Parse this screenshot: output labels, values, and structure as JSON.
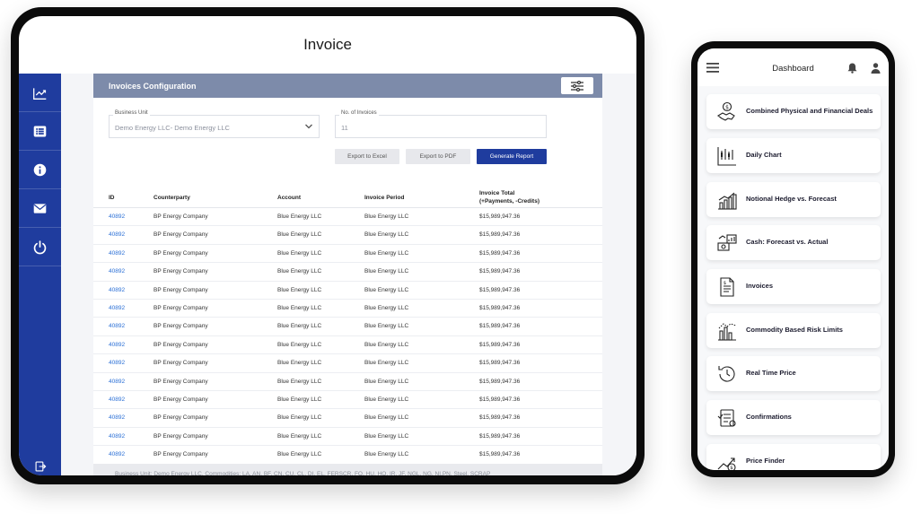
{
  "tablet": {
    "header_title": "Invoice",
    "sidebar_icons": [
      "chart-line-icon",
      "list-icon",
      "info-icon",
      "mail-icon",
      "power-icon"
    ],
    "logout_icon": "logout-icon",
    "config": {
      "title": "Invoices Configuration",
      "settings_icon": "sliders-icon",
      "business_unit_label": "Business Unit",
      "business_unit_value": "Demo Energy LLC- Demo Energy LLC",
      "num_invoices_label": "No. of Invoices",
      "num_invoices_value": "11",
      "export_excel": "Export to Excel",
      "export_pdf": "Export to PDF",
      "generate_report": "Generate Report"
    },
    "table": {
      "headers": {
        "id": "ID",
        "counterparty": "Counterparty",
        "account": "Account",
        "period": "Invoice Period",
        "total_line1": "Invoice Total",
        "total_line2": "(+Payments, -Credits)"
      },
      "rows": [
        {
          "id": "40892",
          "counterparty": "BP Energy Company",
          "account": "Blue Energy LLC",
          "period": "Blue Energy LLC",
          "total": "$15,989,947.36"
        },
        {
          "id": "40892",
          "counterparty": "BP Energy Company",
          "account": "Blue Energy LLC",
          "period": "Blue Energy LLC",
          "total": "$15,989,947.36"
        },
        {
          "id": "40892",
          "counterparty": "BP Energy Company",
          "account": "Blue Energy LLC",
          "period": "Blue Energy LLC",
          "total": "$15,989,947.36"
        },
        {
          "id": "40892",
          "counterparty": "BP Energy Company",
          "account": "Blue Energy LLC",
          "period": "Blue Energy LLC",
          "total": "$15,989,947.36"
        },
        {
          "id": "40892",
          "counterparty": "BP Energy Company",
          "account": "Blue Energy LLC",
          "period": "Blue Energy LLC",
          "total": "$15,989,947.36"
        },
        {
          "id": "40892",
          "counterparty": "BP Energy Company",
          "account": "Blue Energy LLC",
          "period": "Blue Energy LLC",
          "total": "$15,989,947.36"
        },
        {
          "id": "40892",
          "counterparty": "BP Energy Company",
          "account": "Blue Energy LLC",
          "period": "Blue Energy LLC",
          "total": "$15,989,947.36"
        },
        {
          "id": "40892",
          "counterparty": "BP Energy Company",
          "account": "Blue Energy LLC",
          "period": "Blue Energy LLC",
          "total": "$15,989,947.36"
        },
        {
          "id": "40892",
          "counterparty": "BP Energy Company",
          "account": "Blue Energy LLC",
          "period": "Blue Energy LLC",
          "total": "$15,989,947.36"
        },
        {
          "id": "40892",
          "counterparty": "BP Energy Company",
          "account": "Blue Energy LLC",
          "period": "Blue Energy LLC",
          "total": "$15,989,947.36"
        },
        {
          "id": "40892",
          "counterparty": "BP Energy Company",
          "account": "Blue Energy LLC",
          "period": "Blue Energy LLC",
          "total": "$15,989,947.36"
        },
        {
          "id": "40892",
          "counterparty": "BP Energy Company",
          "account": "Blue Energy LLC",
          "period": "Blue Energy LLC",
          "total": "$15,989,947.36"
        },
        {
          "id": "40892",
          "counterparty": "BP Energy Company",
          "account": "Blue Energy LLC",
          "period": "Blue Energy LLC",
          "total": "$15,989,947.36"
        },
        {
          "id": "40892",
          "counterparty": "BP Energy Company",
          "account": "Blue Energy LLC",
          "period": "Blue Energy LLC",
          "total": "$15,989,947.36"
        }
      ]
    },
    "footer_text": "Business Unit: Demo Energy LLC, Commodities: LA, AN, BF, CN, CU, CL, DI, EL, FERSCR, FO, HU, HO, IR, JF, NGL, NG, NI,PN, Steel, SCRAP"
  },
  "phone": {
    "title": "Dashboard",
    "menu_icon": "hamburger-menu-icon",
    "bell_icon": "bell-icon",
    "user_icon": "user-icon",
    "cards": [
      {
        "label": "Combined Physical and Financial Deals",
        "icon": "handshake-dollar-icon"
      },
      {
        "label": "Daily Chart",
        "icon": "candlestick-chart-icon"
      },
      {
        "label": "Notional Hedge vs. Forecast",
        "icon": "bar-trend-chart-icon"
      },
      {
        "label": "Cash: Forecast vs. Actual",
        "icon": "cash-chart-icon"
      },
      {
        "label": "Invoices",
        "icon": "invoice-document-icon"
      },
      {
        "label": "Commodity Based Risk Limits",
        "icon": "risk-bar-chart-icon"
      },
      {
        "label": "Real Time Price",
        "icon": "clock-refresh-icon"
      },
      {
        "label": "Confirmations",
        "icon": "confirmation-doc-icon"
      },
      {
        "label": "Price Finder",
        "icon": "price-finder-icon"
      }
    ]
  },
  "colors": {
    "accent_blue": "#1f3c9e",
    "config_bar": "#7d8baa",
    "link_blue": "#2a6fd6"
  }
}
